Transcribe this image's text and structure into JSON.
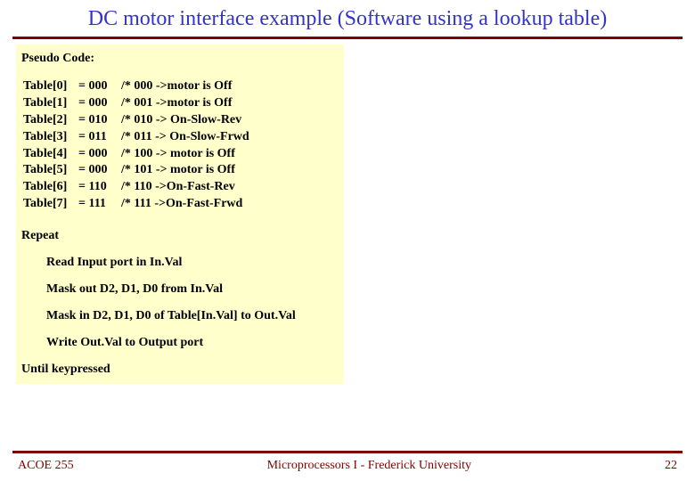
{
  "slide": {
    "title": "DC motor interface example (Software using a lookup table)",
    "pseudoHeader": "Pseudo Code:",
    "table": [
      {
        "idx": "Table[0]",
        "val": "= 000",
        "cmt": "/* 000 ->motor is Off"
      },
      {
        "idx": "Table[1]",
        "val": "= 000",
        "cmt": "/* 001 ->motor is Off"
      },
      {
        "idx": "Table[2]",
        "val": "= 010",
        "cmt": "/* 010 -> On-Slow-Rev"
      },
      {
        "idx": "Table[3]",
        "val": "= 011",
        "cmt": "/* 011 -> On-Slow-Frwd"
      },
      {
        "idx": "Table[4]",
        "val": "= 000",
        "cmt": " /* 100 -> motor is Off"
      },
      {
        "idx": "Table[5]",
        "val": "= 000",
        "cmt": " /* 101 -> motor is Off"
      },
      {
        "idx": "Table[6]",
        "val": "= 110",
        "cmt": " /* 110 ->On-Fast-Rev"
      },
      {
        "idx": "Table[7]",
        "val": "= 111",
        "cmt": " /* 111 ->On-Fast-Frwd"
      }
    ],
    "repeat": "Repeat",
    "steps": [
      "Read Input port in In.Val",
      "Mask out D2, D1, D0 from In.Val",
      "Mask in D2, D1, D0 of Table[In.Val] to Out.Val",
      "Write Out.Val to Output port"
    ],
    "until": "Until keypressed"
  },
  "footer": {
    "left": "ACOE 255",
    "center": "Microprocessors I - Frederick University",
    "right": "22"
  }
}
